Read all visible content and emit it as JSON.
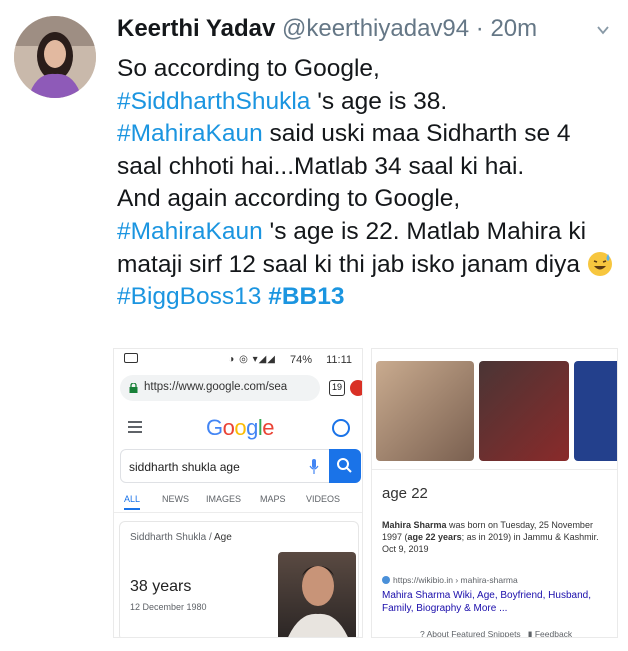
{
  "tweet": {
    "author_name": "Keerthi Yadav",
    "author_handle": "@keerthiyadav94",
    "time_sep": " · ",
    "time": "20m",
    "line1": "So according to Google,",
    "tag_siddharth": "#SiddharthShukla",
    "line2_rest": " 's age is 38.",
    "tag_mahira1": "#MahiraKaun",
    "line3_rest": " said uski maa Sidharth se 4 saal chhoti hai...Matlab 34 saal ki hai.",
    "line4": "And again according to Google,",
    "tag_mahira2": "#MahiraKaun",
    "line5_rest": " 's age is 22. Matlab Mahira ki mataji sirf 12 saal ki thi jab isko janam diya",
    "tag_biggboss": "#BiggBoss13",
    "tag_bb13": "#BB13"
  },
  "icons": {
    "avatar": "profile-photo",
    "caret": "chevron-down-icon",
    "emoji": "sweat-smile-emoji"
  },
  "left_screenshot": {
    "battery": "74%",
    "clock": "11:11",
    "url": "https://www.google.com/sea",
    "tab_count": "19",
    "logo": [
      "G",
      "o",
      "o",
      "g",
      "l",
      "e"
    ],
    "logo_colors": [
      "#4285f4",
      "#ea4335",
      "#fbbc05",
      "#4285f4",
      "#34a853",
      "#ea4335"
    ],
    "search_query": "siddharth shukla age",
    "tabs": [
      "ALL",
      "NEWS",
      "IMAGES",
      "MAPS",
      "VIDEOS"
    ],
    "crumb_name": "Siddharth Shukla",
    "crumb_sep": " / ",
    "crumb_attr": "Age",
    "age": "38 years",
    "birth_date": "12 December 1980"
  },
  "right_screenshot": {
    "age": "age 22",
    "snippet_name": "Mahira Sharma",
    "snippet_text": " was born on Tuesday, 25 November 1997 (",
    "snippet_age_bold": "age 22 years",
    "snippet_tail": "; as in 2019) in Jammu & Kashmir.  Oct 9, 2019",
    "source": "https://wikibio.in › mahira-sharma",
    "link_title": "Mahira Sharma Wiki, Age, Boyfriend, Husband, Family, Biography & More ...",
    "footer_about": "About Featured Snippets",
    "footer_feedback": "Feedback"
  },
  "colors": {
    "hashtag": "#1b95e0",
    "google_blue": "#1a73e8"
  }
}
